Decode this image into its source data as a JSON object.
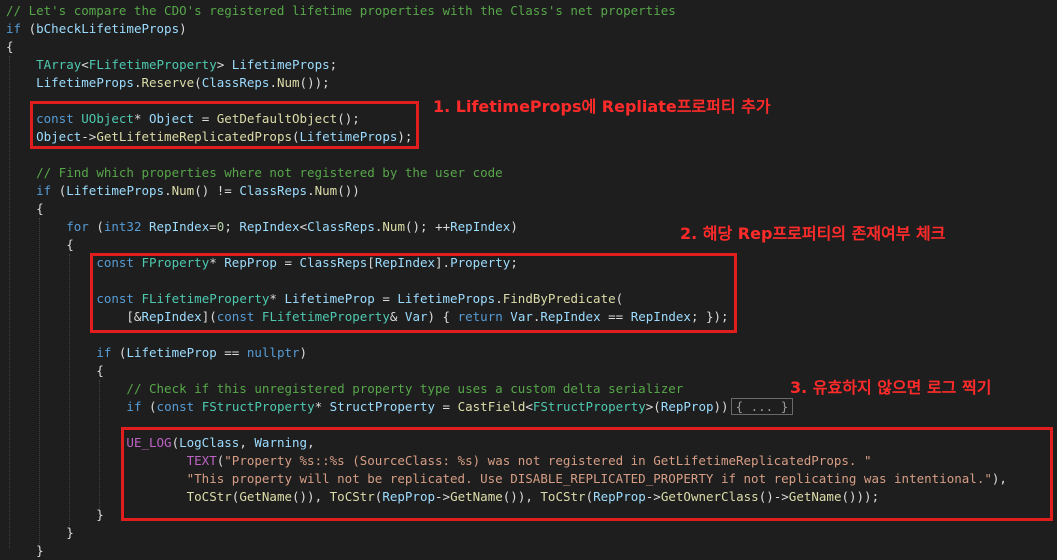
{
  "code": {
    "lines": [
      [
        [
          "cm",
          "// Let's compare the CDO's registered lifetime properties with the Class's net properties"
        ]
      ],
      [
        [
          "kw",
          "if"
        ],
        [
          "pl",
          " ("
        ],
        [
          "va",
          "bCheckLifetimeProps"
        ],
        [
          "pl",
          ")"
        ]
      ],
      [
        [
          "pl",
          "{"
        ]
      ],
      [
        [
          "pl",
          "    "
        ],
        [
          "ty",
          "TArray"
        ],
        [
          "pl",
          "<"
        ],
        [
          "ty",
          "FLifetimeProperty"
        ],
        [
          "pl",
          "> "
        ],
        [
          "va",
          "LifetimeProps"
        ],
        [
          "pl",
          ";"
        ]
      ],
      [
        [
          "pl",
          "    "
        ],
        [
          "va",
          "LifetimeProps"
        ],
        [
          "pl",
          "."
        ],
        [
          "fn",
          "Reserve"
        ],
        [
          "pl",
          "("
        ],
        [
          "va",
          "ClassReps"
        ],
        [
          "pl",
          "."
        ],
        [
          "fn",
          "Num"
        ],
        [
          "pl",
          "());"
        ]
      ],
      [
        [
          "pl",
          ""
        ]
      ],
      [
        [
          "pl",
          "    "
        ],
        [
          "kw",
          "const"
        ],
        [
          "pl",
          " "
        ],
        [
          "ty",
          "UObject"
        ],
        [
          "pl",
          "* "
        ],
        [
          "va",
          "Object"
        ],
        [
          "pl",
          " = "
        ],
        [
          "fn",
          "GetDefaultObject"
        ],
        [
          "pl",
          "();"
        ]
      ],
      [
        [
          "pl",
          "    "
        ],
        [
          "va",
          "Object"
        ],
        [
          "pl",
          "->"
        ],
        [
          "fn",
          "GetLifetimeReplicatedProps"
        ],
        [
          "pl",
          "("
        ],
        [
          "va",
          "LifetimeProps"
        ],
        [
          "pl",
          ");"
        ]
      ],
      [
        [
          "pl",
          ""
        ]
      ],
      [
        [
          "pl",
          "    "
        ],
        [
          "cm",
          "// Find which properties where not registered by the user code"
        ]
      ],
      [
        [
          "pl",
          "    "
        ],
        [
          "kw",
          "if"
        ],
        [
          "pl",
          " ("
        ],
        [
          "va",
          "LifetimeProps"
        ],
        [
          "pl",
          "."
        ],
        [
          "fn",
          "Num"
        ],
        [
          "pl",
          "() != "
        ],
        [
          "va",
          "ClassReps"
        ],
        [
          "pl",
          "."
        ],
        [
          "fn",
          "Num"
        ],
        [
          "pl",
          "())"
        ]
      ],
      [
        [
          "pl",
          "    {"
        ]
      ],
      [
        [
          "pl",
          "        "
        ],
        [
          "kw",
          "for"
        ],
        [
          "pl",
          " ("
        ],
        [
          "kw",
          "int32"
        ],
        [
          "pl",
          " "
        ],
        [
          "va",
          "RepIndex"
        ],
        [
          "pl",
          "="
        ],
        [
          "nu",
          "0"
        ],
        [
          "pl",
          "; "
        ],
        [
          "va",
          "RepIndex"
        ],
        [
          "pl",
          "<"
        ],
        [
          "va",
          "ClassReps"
        ],
        [
          "pl",
          "."
        ],
        [
          "fn",
          "Num"
        ],
        [
          "pl",
          "(); ++"
        ],
        [
          "va",
          "RepIndex"
        ],
        [
          "pl",
          ")"
        ]
      ],
      [
        [
          "pl",
          "        {"
        ]
      ],
      [
        [
          "pl",
          "            "
        ],
        [
          "kw",
          "const"
        ],
        [
          "pl",
          " "
        ],
        [
          "ty",
          "FProperty"
        ],
        [
          "pl",
          "* "
        ],
        [
          "va",
          "RepProp"
        ],
        [
          "pl",
          " = "
        ],
        [
          "va",
          "ClassReps"
        ],
        [
          "pl",
          "["
        ],
        [
          "va",
          "RepIndex"
        ],
        [
          "pl",
          "]."
        ],
        [
          "va",
          "Property"
        ],
        [
          "pl",
          ";"
        ]
      ],
      [
        [
          "pl",
          ""
        ]
      ],
      [
        [
          "pl",
          "            "
        ],
        [
          "kw",
          "const"
        ],
        [
          "pl",
          " "
        ],
        [
          "ty",
          "FLifetimeProperty"
        ],
        [
          "pl",
          "* "
        ],
        [
          "va",
          "LifetimeProp"
        ],
        [
          "pl",
          " = "
        ],
        [
          "va",
          "LifetimeProps"
        ],
        [
          "pl",
          "."
        ],
        [
          "fn",
          "FindByPredicate"
        ],
        [
          "pl",
          "("
        ]
      ],
      [
        [
          "pl",
          "                [&"
        ],
        [
          "va",
          "RepIndex"
        ],
        [
          "pl",
          "]("
        ],
        [
          "kw",
          "const"
        ],
        [
          "pl",
          " "
        ],
        [
          "ty",
          "FLifetimeProperty"
        ],
        [
          "pl",
          "& "
        ],
        [
          "va",
          "Var"
        ],
        [
          "pl",
          ") { "
        ],
        [
          "kw",
          "return"
        ],
        [
          "pl",
          " "
        ],
        [
          "va",
          "Var"
        ],
        [
          "pl",
          "."
        ],
        [
          "va",
          "RepIndex"
        ],
        [
          "pl",
          " == "
        ],
        [
          "va",
          "RepIndex"
        ],
        [
          "pl",
          "; });"
        ]
      ],
      [
        [
          "pl",
          ""
        ]
      ],
      [
        [
          "pl",
          "            "
        ],
        [
          "kw",
          "if"
        ],
        [
          "pl",
          " ("
        ],
        [
          "va",
          "LifetimeProp"
        ],
        [
          "pl",
          " == "
        ],
        [
          "kw",
          "nullptr"
        ],
        [
          "pl",
          ")"
        ]
      ],
      [
        [
          "pl",
          "            {"
        ]
      ],
      [
        [
          "pl",
          "                "
        ],
        [
          "cm",
          "// Check if this unregistered property type uses a custom delta serializer"
        ]
      ],
      [
        [
          "pl",
          "                "
        ],
        [
          "kw",
          "if"
        ],
        [
          "pl",
          " ("
        ],
        [
          "kw",
          "const"
        ],
        [
          "pl",
          " "
        ],
        [
          "ty",
          "FStructProperty"
        ],
        [
          "pl",
          "* "
        ],
        [
          "va",
          "StructProperty"
        ],
        [
          "pl",
          " = "
        ],
        [
          "fn",
          "CastField"
        ],
        [
          "pl",
          "<"
        ],
        [
          "ty",
          "FStructProperty"
        ],
        [
          "pl",
          ">("
        ],
        [
          "va",
          "RepProp"
        ],
        [
          "pl",
          "))"
        ],
        [
          "fold",
          "{ ... }"
        ]
      ],
      [
        [
          "pl",
          ""
        ]
      ],
      [
        [
          "pl",
          "                "
        ],
        [
          "mc",
          "UE_LOG"
        ],
        [
          "pl",
          "("
        ],
        [
          "va",
          "LogClass"
        ],
        [
          "pl",
          ", "
        ],
        [
          "va",
          "Warning"
        ],
        [
          "pl",
          ","
        ]
      ],
      [
        [
          "pl",
          "                        "
        ],
        [
          "mc",
          "TEXT"
        ],
        [
          "pl",
          "("
        ],
        [
          "st",
          "\"Property %s::%s (SourceClass: %s) was not registered in GetLifetimeReplicatedProps. \""
        ]
      ],
      [
        [
          "pl",
          "                        "
        ],
        [
          "st",
          "\"This property will not be replicated. Use DISABLE_REPLICATED_PROPERTY if not replicating was intentional.\""
        ],
        [
          "pl",
          "),"
        ]
      ],
      [
        [
          "pl",
          "                        "
        ],
        [
          "fn",
          "ToCStr"
        ],
        [
          "pl",
          "("
        ],
        [
          "fn",
          "GetName"
        ],
        [
          "pl",
          "()), "
        ],
        [
          "fn",
          "ToCStr"
        ],
        [
          "pl",
          "("
        ],
        [
          "va",
          "RepProp"
        ],
        [
          "pl",
          "->"
        ],
        [
          "fn",
          "GetName"
        ],
        [
          "pl",
          "()), "
        ],
        [
          "fn",
          "ToCStr"
        ],
        [
          "pl",
          "("
        ],
        [
          "va",
          "RepProp"
        ],
        [
          "pl",
          "->"
        ],
        [
          "fn",
          "GetOwnerClass"
        ],
        [
          "pl",
          "()->"
        ],
        [
          "fn",
          "GetName"
        ],
        [
          "pl",
          "()));"
        ]
      ],
      [
        [
          "pl",
          "            }"
        ]
      ],
      [
        [
          "pl",
          "        }"
        ]
      ],
      [
        [
          "pl",
          "    }"
        ]
      ]
    ]
  },
  "annotations": {
    "note1": "1. LifetimeProps에 Repliate프로퍼티 추가",
    "note2": "2. 해당 Rep프로퍼티의 존재여부 체크",
    "note3": "3. 유효하지 않으면 로그 찍기"
  }
}
